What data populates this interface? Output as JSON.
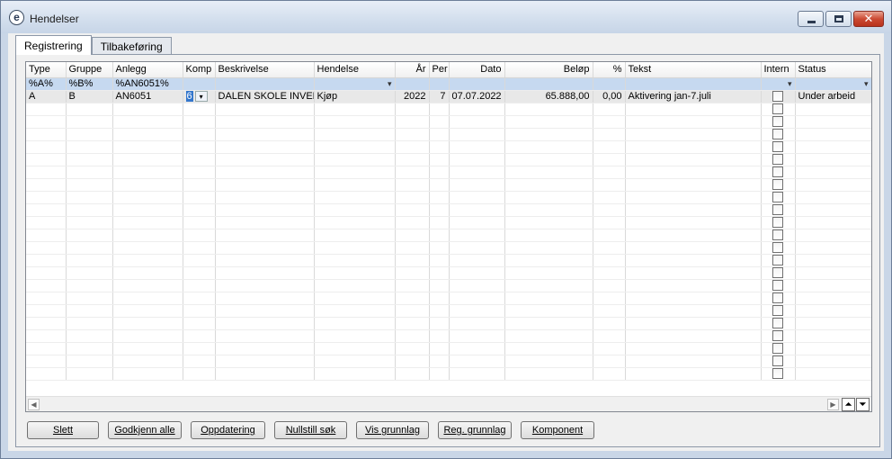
{
  "window": {
    "title": "Hendelser",
    "close_glyph": "✕"
  },
  "tabs": [
    {
      "label": "Registrering",
      "active": true
    },
    {
      "label": "Tilbakeføring",
      "active": false
    }
  ],
  "grid": {
    "columns": [
      "Type",
      "Gruppe",
      "Anlegg",
      "Komp",
      "Beskrivelse",
      "Hendelse",
      "År",
      "Per",
      "Dato",
      "Beløp",
      "%",
      "Tekst",
      "Intern",
      "Status"
    ],
    "filter": {
      "type": "%A%",
      "gruppe": "%B%",
      "anlegg": "%AN6051%"
    },
    "row": {
      "type": "A",
      "gruppe": "B",
      "anlegg": "AN6051",
      "komp": "6",
      "beskrivelse": "DALEN SKOLE INVENT",
      "hendelse": "Kjøp",
      "ar": "2022",
      "per": "7",
      "dato": "07.07.2022",
      "belop": "65.888,00",
      "pct": "0,00",
      "tekst": "Aktivering jan-7.juli",
      "status": "Under arbeid"
    }
  },
  "buttons": {
    "slett": "Slett",
    "godkjenn": "Godkjenn alle",
    "oppdatering": "Oppdatering",
    "nullstill": "Nullstill søk",
    "vis": "Vis grunnlag",
    "reg": "Reg. grunnlag",
    "komponent": "Komponent"
  }
}
